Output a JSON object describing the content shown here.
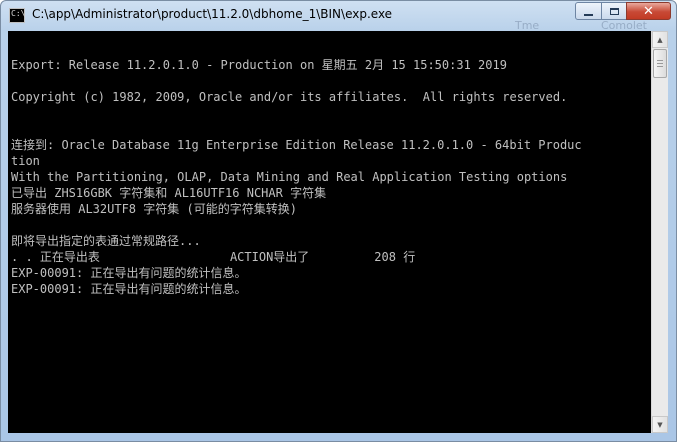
{
  "window": {
    "title": "C:\\app\\Administrator\\product\\11.2.0\\dbhome_1\\BIN\\exp.exe",
    "icon": "cmd-console-icon",
    "ghost_labels": [
      "Tme",
      "Comolet"
    ]
  },
  "caption": {
    "minimize_icon": "minimize-icon",
    "maximize_icon": "maximize-icon",
    "close_icon": "close-icon",
    "close_glyph": "✕"
  },
  "console": {
    "foreground": "#c0c0c0",
    "background": "#000000",
    "lines": [
      {
        "row": 0,
        "text": ""
      },
      {
        "row": 1,
        "text": "Export: Release 11.2.0.1.0 - Production on 星期五 2月 15 15:50:31 2019"
      },
      {
        "row": 2,
        "text": ""
      },
      {
        "row": 3,
        "text": "Copyright (c) 1982, 2009, Oracle and/or its affiliates.  All rights reserved."
      },
      {
        "row": 4,
        "text": ""
      },
      {
        "row": 5,
        "text": ""
      },
      {
        "row": 6,
        "text": "连接到: Oracle Database 11g Enterprise Edition Release 11.2.0.1.0 - 64bit Produc"
      },
      {
        "row": 7,
        "text": "tion"
      },
      {
        "row": 8,
        "text": "With the Partitioning, OLAP, Data Mining and Real Application Testing options"
      },
      {
        "row": 9,
        "text": "已导出 ZHS16GBK 字符集和 AL16UTF16 NCHAR 字符集"
      },
      {
        "row": 10,
        "text": "服务器使用 AL32UTF8 字符集 (可能的字符集转换)"
      },
      {
        "row": 11,
        "text": ""
      },
      {
        "row": 12,
        "text": "即将导出指定的表通过常规路径..."
      },
      {
        "row": 13,
        "text": ". . 正在导出表                  ACTION导出了         208 行"
      },
      {
        "row": 14,
        "text": "EXP-00091: 正在导出有问题的统计信息。"
      },
      {
        "row": 15,
        "text": "EXP-00091: 正在导出有问题的统计信息。"
      }
    ]
  },
  "scrollbar": {
    "up_arrow": "▲",
    "down_arrow": "▼",
    "up_icon": "scroll-up-arrow-icon",
    "down_icon": "scroll-down-arrow-icon"
  }
}
